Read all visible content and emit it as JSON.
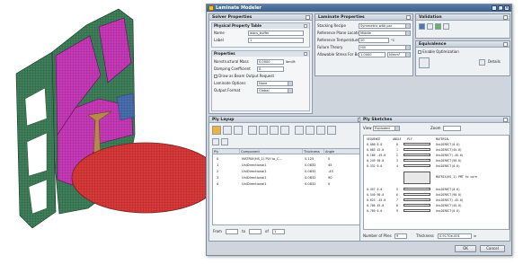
{
  "dialog": {
    "title": "Laminate Modeler",
    "min": "_",
    "max": "□",
    "close": "×"
  },
  "solver": {
    "header": "Solver Properties",
    "physical_table": {
      "header": "Physical Property Table",
      "name_label": "Name",
      "name_value": "wacs_buffer",
      "label_label": "Label",
      "label_value": "1"
    },
    "properties": {
      "header": "Properties",
      "nonstructural_label": "Nonstructural Mass",
      "nonstructural_value": "0.0000",
      "nonstructural_unit": "lbm/ft",
      "damping_label": "Damping Coefficient",
      "damping_value": "0",
      "check_label": "Draw as Beam Output Request",
      "laminate_label": "Laminate Options",
      "laminate_value": "None",
      "output_label": "Output Format",
      "output_value": "Global"
    }
  },
  "laminate": {
    "header": "Laminate Properties",
    "stacking_label": "Stacking Recipe",
    "stacking_value": "Symmetric with par",
    "reference_label": "Reference Plane Location",
    "reference_value": "Middle",
    "temperature_label": "Reference Temperature",
    "temperature_value": "20",
    "temperature_unit": "°C",
    "failure_label": "Failure Theory",
    "failure_value": "Hill",
    "allowable_label": "Allowable Stress For Bond",
    "allowable_value": "1.0000",
    "allowable_unit": "N/mm²"
  },
  "validation": {
    "header": "Validation"
  },
  "equivalence": {
    "header": "Equivalence",
    "enable_label": "Enable Optimization",
    "details_label": "Details"
  },
  "plylayup": {
    "header": "Ply Layup",
    "columns": [
      "Ply",
      "Component",
      "Thickness",
      "Angle"
    ],
    "rows": [
      {
        "ply": "0",
        "component": "MATRIX(HS_1) PLY to_C...",
        "thickness": "0.125",
        "angle": "0"
      },
      {
        "ply": "1",
        "component": "UniDirectional1",
        "thickness": "0.0832",
        "angle": "45"
      },
      {
        "ply": "2",
        "component": "UniDirectional1",
        "thickness": "0.0832",
        "angle": "-45"
      },
      {
        "ply": "3",
        "component": "UniDirectional1",
        "thickness": "0.0832",
        "angle": "90"
      },
      {
        "ply": "4",
        "component": "UniDirectional1",
        "thickness": "0.0832",
        "angle": "0"
      }
    ],
    "from_label": "From",
    "to_label": "to",
    "of_label": "of",
    "of_value": "1"
  },
  "sketch": {
    "header": "Ply Sketches",
    "view_label": "View",
    "view_value": "Exploded",
    "zoom_label": "Zoom",
    "columns": [
      "SEQUENCE",
      "ANGLE",
      "PLY",
      "MATERIAL"
    ],
    "top_rows": [
      {
        "seq": "0.000 0.0",
        "angle": "0",
        "mat": "UniDIRECT(0.0)"
      },
      {
        "seq": "0.083 45.0",
        "angle": "1",
        "mat": "UniDIRECT(45.0)"
      },
      {
        "seq": "0.166 -45.0",
        "angle": "2",
        "mat": "UniDIRECT(-45.0)"
      },
      {
        "seq": "0.249 90.0",
        "angle": "3",
        "mat": "UniDIRECT(90.0)"
      },
      {
        "seq": "0.332 0.0",
        "angle": "4",
        "mat": "UniDIRECT(0.0)"
      }
    ],
    "core_label": "MATRIX(HS_1) PMT to core",
    "bottom_rows": [
      {
        "seq": "0.457 0.0",
        "angle": "5",
        "mat": "UniDIRECT(0.0)"
      },
      {
        "seq": "0.540 90.0",
        "angle": "6",
        "mat": "UniDIRECT(90.0)"
      },
      {
        "seq": "0.623 -45.0",
        "angle": "7",
        "mat": "UniDIRECT(-45.0)"
      },
      {
        "seq": "0.706 45.0",
        "angle": "8",
        "mat": "UniDIRECT(45.0)"
      },
      {
        "seq": "0.789 0.0",
        "angle": "9",
        "mat": "UniDIRECT(0.0)"
      }
    ],
    "num_plies_label": "Number of Plies",
    "num_plies_value": "9",
    "thickness_label": "Thickness",
    "thickness_value": "0.9170e-001",
    "thickness_unit": "in"
  },
  "buttons": {
    "ok": "OK",
    "cancel": "Cancel"
  },
  "colors": {
    "mesh_green": "#3f7f5a",
    "mesh_magenta": "#c63ab8",
    "mesh_red": "#d83a3a",
    "mesh_tan": "#b8874a",
    "title_blue": "#3c5f8a"
  }
}
